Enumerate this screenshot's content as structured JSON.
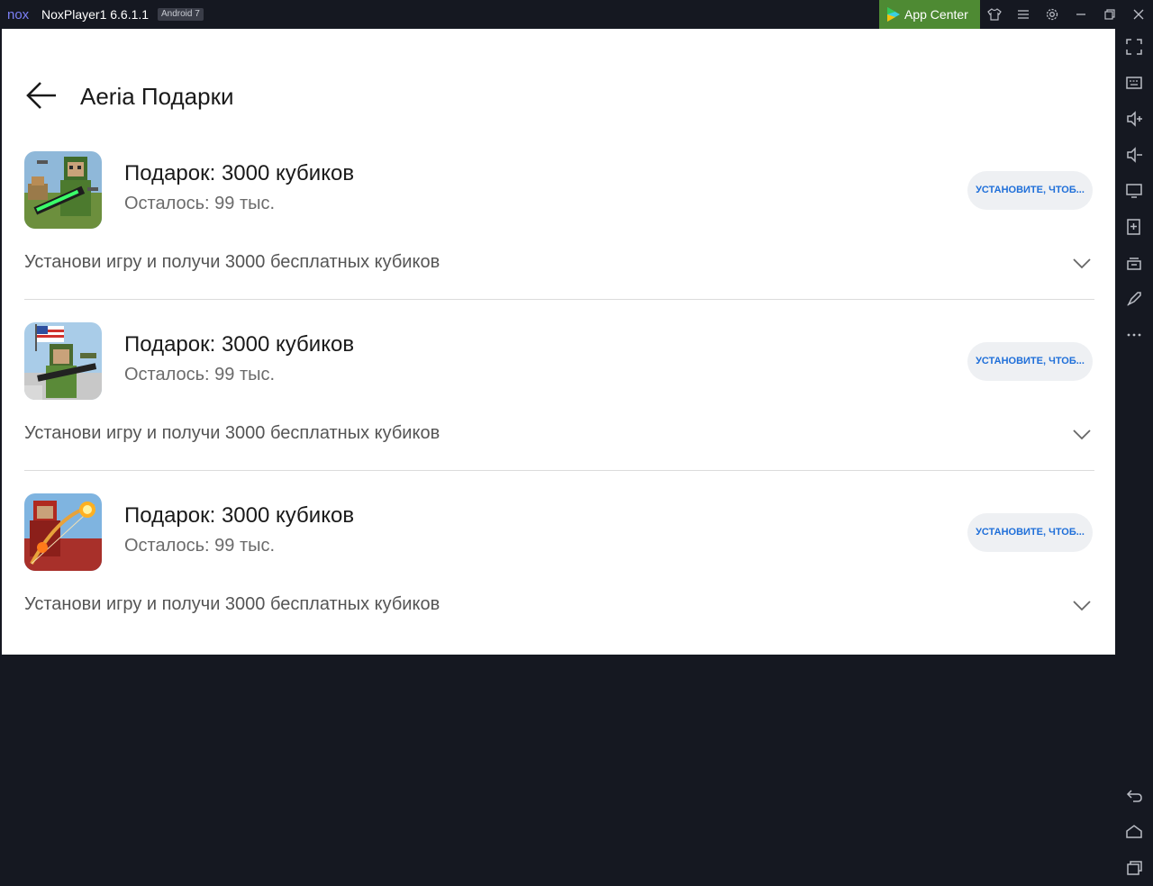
{
  "titlebar": {
    "logo_text": "nox",
    "title": "NoxPlayer1 6.6.1.1",
    "android_badge": "Android 7",
    "app_center_label": "App Center",
    "accent_green": "#4e8a33"
  },
  "page": {
    "title": "Aeria Подарки"
  },
  "gifts": [
    {
      "icon": "game-icon-soldier-rifle",
      "title": "Подарок: 3000 кубиков",
      "remaining": "Осталось: 99 тыс.",
      "install_label": "УСТАНОВИТЕ, ЧТОБ...",
      "description": "Установи игру и получи 3000 бесплатных кубиков"
    },
    {
      "icon": "game-icon-soldier-flag",
      "title": "Подарок: 3000 кубиков",
      "remaining": "Осталось: 99 тыс.",
      "install_label": "УСТАНОВИТЕ, ЧТОБ...",
      "description": "Установи игру и получи 3000 бесплатных кубиков"
    },
    {
      "icon": "game-icon-archer-fire",
      "title": "Подарок: 3000 кубиков",
      "remaining": "Осталось: 99 тыс.",
      "install_label": "УСТАНОВИТЕ, ЧТОБ...",
      "description": "Установи игру и получи 3000 бесплатных кубиков"
    }
  ],
  "colors": {
    "button_text": "#1f6fd9",
    "button_bg": "#eef0f3",
    "frame_bg": "#151821"
  }
}
